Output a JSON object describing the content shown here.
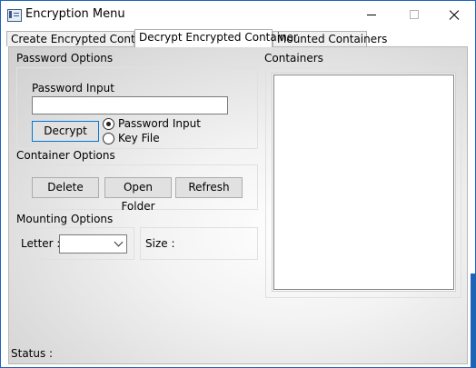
{
  "window": {
    "title": "Encryption Menu"
  },
  "tabs": [
    {
      "label": "Create Encrypted Container"
    },
    {
      "label": "Decrypt Encrypted Container"
    },
    {
      "label": "Mounted Containers"
    }
  ],
  "password_options": {
    "section_label": "Password Options",
    "input_label": "Password Input",
    "input_value": "",
    "decrypt_button": "Decrypt",
    "radio_password": "Password Input",
    "radio_keyfile": "Key File",
    "selected": "Password Input"
  },
  "container_options": {
    "section_label": "Container Options",
    "delete_button": "Delete",
    "open_folder_button": "Open Folder",
    "refresh_button": "Refresh"
  },
  "mounting_options": {
    "section_label": "Mounting Options",
    "letter_label": "Letter :",
    "letter_value": "",
    "size_label": "Size :"
  },
  "containers": {
    "section_label": "Containers",
    "items": []
  },
  "status": {
    "label": "Status :"
  }
}
